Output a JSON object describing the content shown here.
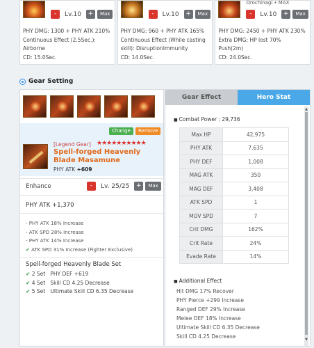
{
  "skills": [
    {
      "name": "",
      "level": "Lv.10",
      "minus": "-",
      "plus": "+",
      "max": "Max",
      "desc": [
        "PHY DMG: 1300 + PHY ATK 210%",
        "Continuous Effect (2.5Sec.):",
        "Airborne",
        "CD: 15.0Sec."
      ]
    },
    {
      "name": "",
      "level": "Lv.10",
      "minus": "-",
      "plus": "+",
      "max": "Max",
      "desc": [
        "PHY DMG: 960 + PHY ATK 165%",
        "Continuous Effect (While casting",
        "skill): DisruptionImmunity",
        "CD: 14.0Sec."
      ]
    },
    {
      "name": "Orochinagi  • MAX",
      "level": "Lv.10",
      "minus": "-",
      "plus": "+",
      "max": "Max",
      "desc": [
        "PHY DMG: 2450 + PHY ATK 230%",
        "Extra DMG: HP lost 70%",
        "Push(2m)",
        "CD: 24.0Sec."
      ]
    }
  ],
  "gear_setting": {
    "title": "Gear Setting",
    "change": "Change",
    "remove": "Remove",
    "grade": "[Legend Gear]",
    "stars": "★★★★★★★★★★",
    "weapon_name": "Spell-forged Heavenly Blade Masamune",
    "weapon_atk_label": "PHY ATK",
    "weapon_atk_value": "+609",
    "enhance_label": "Enhance",
    "enhance_level": "Lv. 25/25",
    "minus": "-",
    "plus": "+",
    "max": "Max",
    "phy_atk": "PHY ATK +1,370",
    "options": [
      {
        "text": "- PHY ATK 18% Increase",
        "check": false
      },
      {
        "text": "- ATK SPD 28% Increase",
        "check": false
      },
      {
        "text": "- PHY ATK 14% Increase",
        "check": false
      },
      {
        "text": "ATK SPD 31% Increase (Fighter Exclusive)",
        "check": true
      }
    ],
    "set_title": "Spell-forged Heavenly Blade Set",
    "set_bonuses": [
      {
        "pieces": "2 Set",
        "effect": "PHY DEF +619"
      },
      {
        "pieces": "4 Set",
        "effect": "Skill CD 4.25 Decrease"
      },
      {
        "pieces": "5 Set",
        "effect": "Ultimate Skill CD 6.35 Decrease"
      }
    ]
  },
  "tabs": {
    "gear_effect": "Gear Effect",
    "hero_stat": "Hero Stat"
  },
  "hero_stat": {
    "combat_power": "Combat Power : 29,736",
    "stats": [
      {
        "k": "Max HP",
        "v": "42,975"
      },
      {
        "k": "PHY ATK",
        "v": "7,635"
      },
      {
        "k": "PHY DEF",
        "v": "1,008"
      },
      {
        "k": "MAG ATK",
        "v": "350"
      },
      {
        "k": "MAG DEF",
        "v": "3,408"
      },
      {
        "k": "ATK SPD",
        "v": "1"
      },
      {
        "k": "MOV SPD",
        "v": "7"
      },
      {
        "k": "Crit DMG",
        "v": "162%"
      },
      {
        "k": "Crit Rate",
        "v": "24%"
      },
      {
        "k": "Evade Rate",
        "v": "14%"
      }
    ],
    "additional_title": "Additional Effect",
    "additional": [
      "Hit DMG 17% Recover",
      "PHY Pierce +299 Increase",
      "Ranged DEF 29% Increase",
      "Melee DEF 18% Increase",
      "Ultimate Skill CD 6.35 Decrease",
      "Skill CD 4.25 Decrease"
    ]
  },
  "colors": {
    "accent": "#4aa8e8",
    "danger": "#d9352d",
    "orange": "#e06a1a",
    "green": "#2e9b3b"
  }
}
